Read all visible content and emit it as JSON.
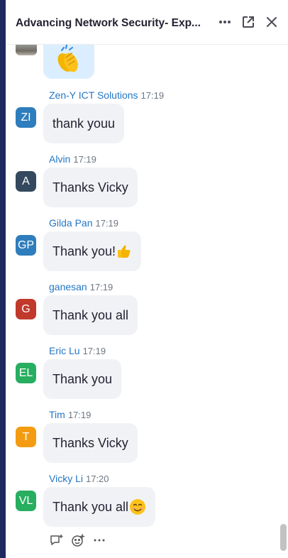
{
  "header": {
    "title": "Advancing Network Security- Exp...",
    "more_icon": "more-horizontal-icon",
    "popout_icon": "popout-icon",
    "close_icon": "close-icon"
  },
  "first_message": {
    "reaction_emoji": "clapping-hands-emoji"
  },
  "messages": [
    {
      "initials": "ZI",
      "sender": "Zen-Y ICT Solutions",
      "time": "17:19",
      "text": "thank youu",
      "color": "#2e7dbd"
    },
    {
      "initials": "A",
      "sender": "Alvin",
      "time": "17:19",
      "text": "Thanks Vicky",
      "color": "#34495e"
    },
    {
      "initials": "GP",
      "sender": "Gilda Pan",
      "time": "17:19",
      "text": "Thank you!",
      "emoji": "thumbs-up-emoji",
      "color": "#2e7dbd"
    },
    {
      "initials": "G",
      "sender": "ganesan",
      "time": "17:19",
      "text": "Thank you all",
      "color": "#c0392b"
    },
    {
      "initials": "EL",
      "sender": "Eric Lu",
      "time": "17:19",
      "text": "Thank you",
      "color": "#27ae60"
    },
    {
      "initials": "T",
      "sender": "Tim",
      "time": "17:19",
      "text": "Thanks Vicky",
      "color": "#f39c12"
    },
    {
      "initials": "VL",
      "sender": "Vicky Li",
      "time": "17:20",
      "text": "Thank you all",
      "emoji": "smiling-face-emoji",
      "color": "#27ae60"
    }
  ],
  "message_actions": [
    "reply-icon",
    "add-reaction-icon",
    "more-icon"
  ]
}
